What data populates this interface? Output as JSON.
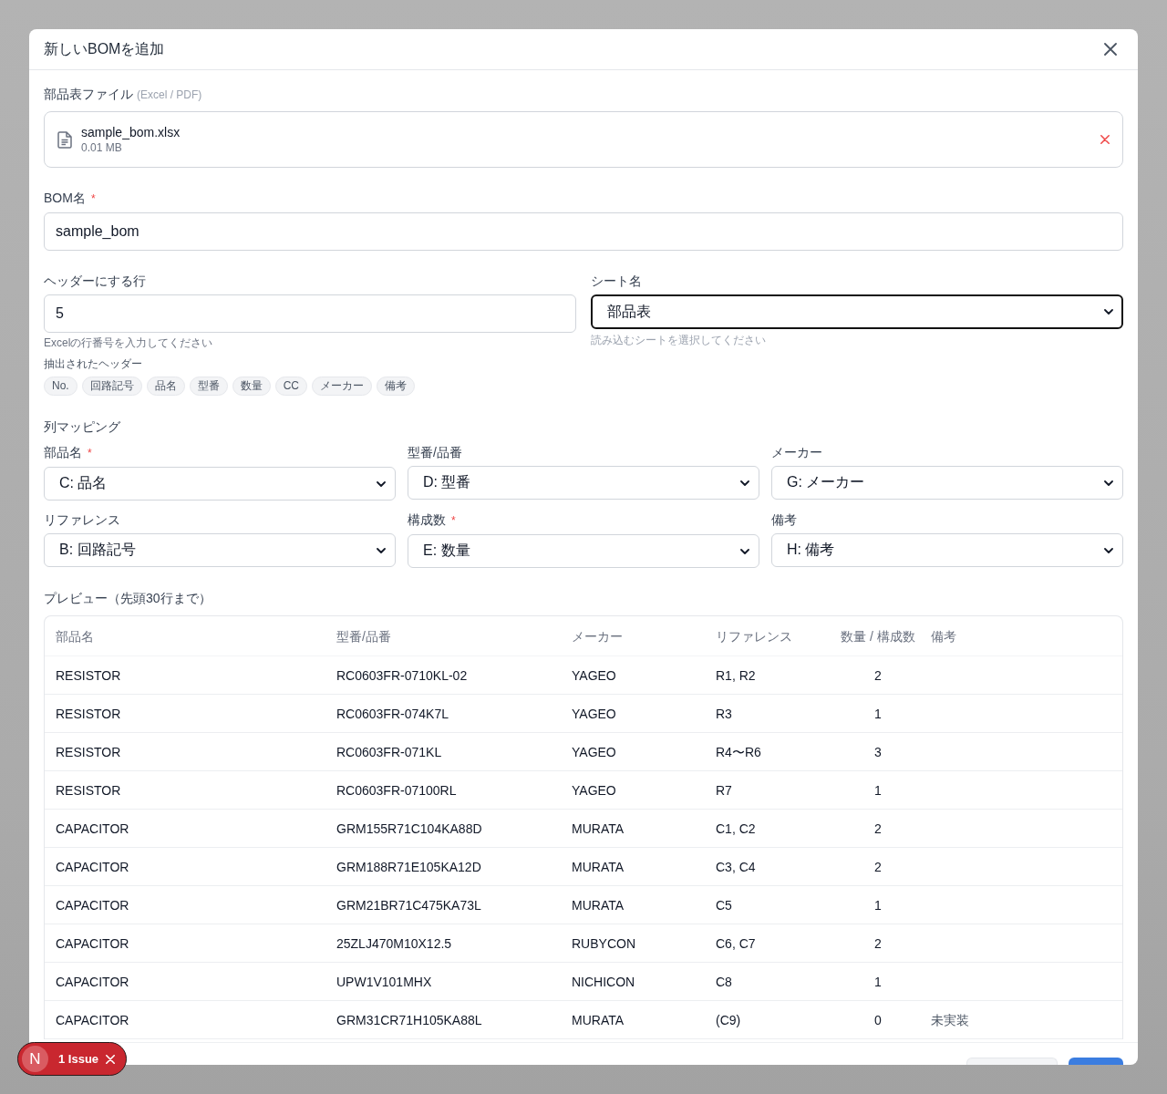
{
  "dialog": {
    "title": "新しいBOMを追加"
  },
  "file_field": {
    "label": "部品表ファイル",
    "hint": "(Excel / PDF)",
    "file": {
      "name": "sample_bom.xlsx",
      "size": "0.01 MB"
    }
  },
  "bom_name": {
    "label": "BOM名",
    "required_mark": "*",
    "value": "sample_bom"
  },
  "header_row": {
    "label": "ヘッダーにする行",
    "value": "5",
    "help": "Excelの行番号を入力してください",
    "extracted_label": "抽出されたヘッダー",
    "extracted_headers": [
      "No.",
      "回路記号",
      "品名",
      "型番",
      "数量",
      "CC",
      "メーカー",
      "備考"
    ]
  },
  "sheet": {
    "label": "シート名",
    "value": "部品表",
    "focused": true,
    "help": "読み込むシートを選択してください"
  },
  "column_mapping": {
    "title": "列マッピング",
    "fields": [
      {
        "label": "部品名",
        "required_mark": "*",
        "value": "C: 品名"
      },
      {
        "label": "型番/品番",
        "value": "D: 型番"
      },
      {
        "label": "メーカー",
        "value": "G: メーカー"
      },
      {
        "label": "リファレンス",
        "value": "B: 回路記号"
      },
      {
        "label": "構成数",
        "required_mark": "*",
        "value": "E: 数量"
      },
      {
        "label": "備考",
        "value": "H: 備考"
      }
    ]
  },
  "preview": {
    "title": "プレビュー（先頭30行まで）",
    "columns": [
      {
        "label": "部品名",
        "kind": "text"
      },
      {
        "label": "型番/品番",
        "kind": "text"
      },
      {
        "label": "メーカー",
        "kind": "text"
      },
      {
        "label": "リファレンス",
        "kind": "text"
      },
      {
        "label": "数量 / 構成数",
        "kind": "number"
      },
      {
        "label": "備考",
        "kind": "note"
      }
    ],
    "rows": [
      {
        "cells": [
          "RESISTOR",
          "RC0603FR-0710KL-02",
          "YAGEO",
          "R1, R2",
          "2"
        ]
      },
      {
        "cells": [
          "RESISTOR",
          "RC0603FR-074K7L",
          "YAGEO",
          "R3",
          "1"
        ]
      },
      {
        "cells": [
          "RESISTOR",
          "RC0603FR-071KL",
          "YAGEO",
          "R4〜R6",
          "3"
        ]
      },
      {
        "cells": [
          "RESISTOR",
          "RC0603FR-07100RL",
          "YAGEO",
          "R7",
          "1"
        ]
      },
      {
        "cells": [
          "CAPACITOR",
          "GRM155R71C104KA88D",
          "MURATA",
          "C1, C2",
          "2"
        ]
      },
      {
        "cells": [
          "CAPACITOR",
          "GRM188R71E105KA12D",
          "MURATA",
          "C3, C4",
          "2"
        ]
      },
      {
        "cells": [
          "CAPACITOR",
          "GRM21BR71C475KA73L",
          "MURATA",
          "C5",
          "1"
        ]
      },
      {
        "cells": [
          "CAPACITOR",
          "25ZLJ470M10X12.5",
          "RUBYCON",
          "C6, C7",
          "2"
        ]
      },
      {
        "cells": [
          "CAPACITOR",
          "UPW1V101MHX",
          "NICHICON",
          "C8",
          "1"
        ]
      },
      {
        "cells": [
          "CAPACITOR",
          "GRM31CR71H105KA88L",
          "MURATA",
          "(C9)",
          "0",
          "未実装"
        ]
      }
    ]
  },
  "footer": {
    "buttons": [
      {
        "kind": "secondary"
      },
      {
        "kind": "primary"
      }
    ]
  },
  "issue_badge": {
    "logo": "N",
    "label": "1 Issue"
  }
}
